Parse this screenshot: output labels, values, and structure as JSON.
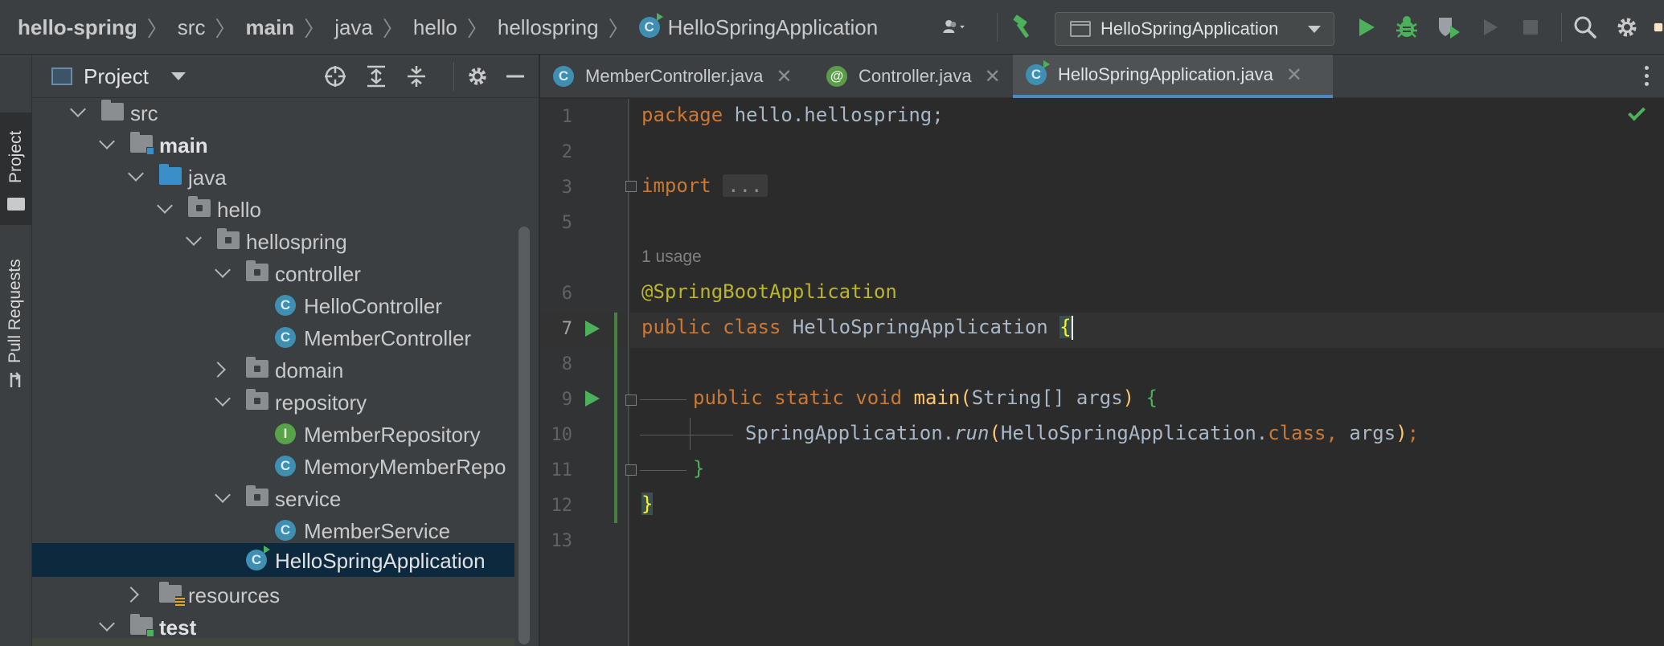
{
  "breadcrumbs": [
    "hello-spring",
    "src",
    "main",
    "java",
    "hello",
    "hellospring",
    "HelloSpringApplication"
  ],
  "run_config": {
    "name": "HelloSpringApplication"
  },
  "toolstrip": {
    "project_label": "Project",
    "pull_requests_label": "Pull Requests"
  },
  "project_panel": {
    "title": "Project"
  },
  "tree": [
    {
      "label": "src",
      "type": "folder",
      "level": 0,
      "state": "expanded"
    },
    {
      "label": "main",
      "type": "folder-src",
      "level": 1,
      "state": "expanded",
      "bold": true
    },
    {
      "label": "java",
      "type": "folder-blue",
      "level": 2,
      "state": "expanded"
    },
    {
      "label": "hello",
      "type": "package",
      "level": 3,
      "state": "expanded"
    },
    {
      "label": "hellospring",
      "type": "package",
      "level": 4,
      "state": "expanded"
    },
    {
      "label": "controller",
      "type": "package",
      "level": 5,
      "state": "expanded"
    },
    {
      "label": "HelloController",
      "type": "class",
      "level": 6
    },
    {
      "label": "MemberController",
      "type": "class",
      "level": 6
    },
    {
      "label": "domain",
      "type": "package",
      "level": 5,
      "state": "collapsed"
    },
    {
      "label": "repository",
      "type": "package",
      "level": 5,
      "state": "expanded"
    },
    {
      "label": "MemberRepository",
      "type": "interface",
      "level": 6
    },
    {
      "label": "MemoryMemberRepo",
      "type": "class",
      "level": 6
    },
    {
      "label": "service",
      "type": "package",
      "level": 5,
      "state": "expanded"
    },
    {
      "label": "MemberService",
      "type": "class",
      "level": 6
    },
    {
      "label": "HelloSpringApplication",
      "type": "class-run",
      "level": 5,
      "selected": true
    },
    {
      "label": "resources",
      "type": "folder-res",
      "level": 3,
      "state": "collapsed"
    },
    {
      "label": "test",
      "type": "folder-src",
      "level": 1,
      "state": "expanded",
      "bold": true
    }
  ],
  "tabs": [
    {
      "label": "MemberController.java",
      "icon": "class-icon",
      "active": false
    },
    {
      "label": "Controller.java",
      "icon": "annotation-icon",
      "active": false
    },
    {
      "label": "HelloSpringApplication.java",
      "icon": "class-run-icon",
      "active": true
    }
  ],
  "editor": {
    "line_numbers": [
      "1",
      "2",
      "3",
      "5",
      "6",
      "7",
      "8",
      "9",
      "10",
      "11",
      "12",
      "13"
    ],
    "usage_hint": "1 usage",
    "current_line": "7",
    "code": {
      "l1_kw": "package",
      "l1_rest": " hello.hellospring;",
      "l3_kw": "import",
      "l3_fold": "...",
      "l6_ann": "@SpringBootApplication",
      "l7_kw": "public class",
      "l7_name": " HelloSpringApplication ",
      "l7_brace": "{",
      "l9_kw": "public static void",
      "l9_fn": "main",
      "l9_args": "String[] args",
      "l9_brace": "{",
      "l10_obj": "SpringApplication.",
      "l10_method": "run",
      "l10_arg1": "HelloSpringApplication.",
      "l10_kw": "class,",
      "l10_arg2": " args",
      "l10_end": ";",
      "l11_brace": "}",
      "l12_brace": "}"
    }
  },
  "colors": {
    "accent": "#4a88c7",
    "run_green": "#4db05a",
    "keyword": "#cc7832",
    "annotation": "#bbb529",
    "method": "#ffc66d"
  }
}
